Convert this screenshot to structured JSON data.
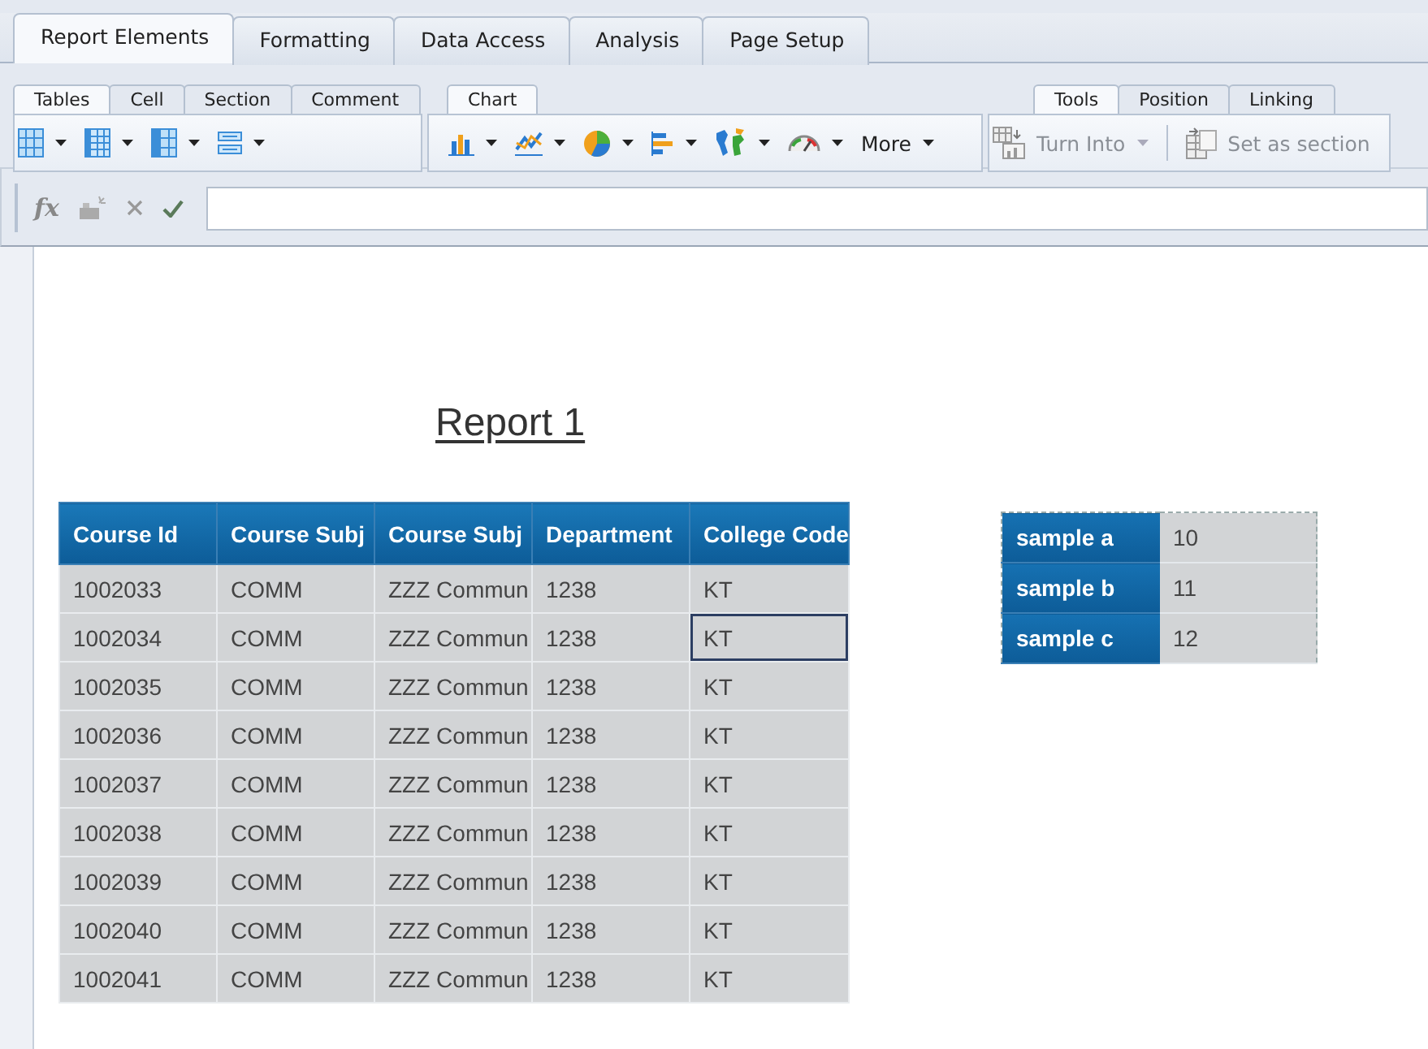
{
  "main_tabs": [
    {
      "label": "Report Elements",
      "selected": true
    },
    {
      "label": "Formatting",
      "selected": false
    },
    {
      "label": "Data Access",
      "selected": false
    },
    {
      "label": "Analysis",
      "selected": false
    },
    {
      "label": "Page Setup",
      "selected": false
    }
  ],
  "ribbon_groups": [
    {
      "tabs": [
        {
          "label": "Tables",
          "selected": true
        },
        {
          "label": "Cell",
          "selected": false
        },
        {
          "label": "Section",
          "selected": false
        },
        {
          "label": "Comment",
          "selected": false
        }
      ],
      "tools": [
        {
          "kind": "table"
        },
        {
          "kind": "crosstab"
        },
        {
          "kind": "form"
        },
        {
          "kind": "list"
        }
      ]
    },
    {
      "tabs": [
        {
          "label": "Chart",
          "selected": true
        }
      ],
      "tools": [
        {
          "kind": "bar"
        },
        {
          "kind": "line"
        },
        {
          "kind": "pie"
        },
        {
          "kind": "hbar"
        },
        {
          "kind": "map"
        },
        {
          "kind": "gauge"
        },
        {
          "kind": "text",
          "label": "More"
        }
      ]
    },
    {
      "tabs": [
        {
          "label": "Tools",
          "selected": true
        },
        {
          "label": "Position",
          "selected": false
        },
        {
          "label": "Linking",
          "selected": false
        }
      ],
      "tools": [
        {
          "kind": "turn",
          "label": "Turn Into",
          "disabled": true
        },
        {
          "kind": "section",
          "label": "Set as section",
          "disabled": true
        }
      ]
    }
  ],
  "formula_bar": {
    "function_label": "fx"
  },
  "report": {
    "title": "Report 1",
    "table": {
      "columns": [
        "Course Id",
        "Course Subj",
        "Course Subj",
        "Department",
        "College Code"
      ],
      "rows": [
        {
          "cells": [
            {
              "text": "1002033",
              "selected": false
            },
            {
              "text": "COMM",
              "selected": false
            },
            {
              "text": "ZZZ Commun",
              "selected": false
            },
            {
              "text": "1238",
              "selected": false
            },
            {
              "text": "KT",
              "selected": false
            }
          ]
        },
        {
          "cells": [
            {
              "text": "1002034",
              "selected": false
            },
            {
              "text": "COMM",
              "selected": false
            },
            {
              "text": "ZZZ Commun",
              "selected": false
            },
            {
              "text": "1238",
              "selected": false
            },
            {
              "text": "KT",
              "selected": true
            }
          ]
        },
        {
          "cells": [
            {
              "text": "1002035",
              "selected": false
            },
            {
              "text": "COMM",
              "selected": false
            },
            {
              "text": "ZZZ Commun",
              "selected": false
            },
            {
              "text": "1238",
              "selected": false
            },
            {
              "text": "KT",
              "selected": false
            }
          ]
        },
        {
          "cells": [
            {
              "text": "1002036",
              "selected": false
            },
            {
              "text": "COMM",
              "selected": false
            },
            {
              "text": "ZZZ Commun",
              "selected": false
            },
            {
              "text": "1238",
              "selected": false
            },
            {
              "text": "KT",
              "selected": false
            }
          ]
        },
        {
          "cells": [
            {
              "text": "1002037",
              "selected": false
            },
            {
              "text": "COMM",
              "selected": false
            },
            {
              "text": "ZZZ Commun",
              "selected": false
            },
            {
              "text": "1238",
              "selected": false
            },
            {
              "text": "KT",
              "selected": false
            }
          ]
        },
        {
          "cells": [
            {
              "text": "1002038",
              "selected": false
            },
            {
              "text": "COMM",
              "selected": false
            },
            {
              "text": "ZZZ Commun",
              "selected": false
            },
            {
              "text": "1238",
              "selected": false
            },
            {
              "text": "KT",
              "selected": false
            }
          ]
        },
        {
          "cells": [
            {
              "text": "1002039",
              "selected": false
            },
            {
              "text": "COMM",
              "selected": false
            },
            {
              "text": "ZZZ Commun",
              "selected": false
            },
            {
              "text": "1238",
              "selected": false
            },
            {
              "text": "KT",
              "selected": false
            }
          ]
        },
        {
          "cells": [
            {
              "text": "1002040",
              "selected": false
            },
            {
              "text": "COMM",
              "selected": false
            },
            {
              "text": "ZZZ Commun",
              "selected": false
            },
            {
              "text": "1238",
              "selected": false
            },
            {
              "text": "KT",
              "selected": false
            }
          ]
        },
        {
          "cells": [
            {
              "text": "1002041",
              "selected": false
            },
            {
              "text": "COMM",
              "selected": false
            },
            {
              "text": "ZZZ Commun",
              "selected": false
            },
            {
              "text": "1238",
              "selected": false
            },
            {
              "text": "KT",
              "selected": false
            }
          ]
        }
      ]
    },
    "sample_table": {
      "rows": [
        {
          "label": "sample a",
          "value": "10"
        },
        {
          "label": "sample b",
          "value": "11"
        },
        {
          "label": "sample c",
          "value": "12"
        }
      ]
    }
  }
}
